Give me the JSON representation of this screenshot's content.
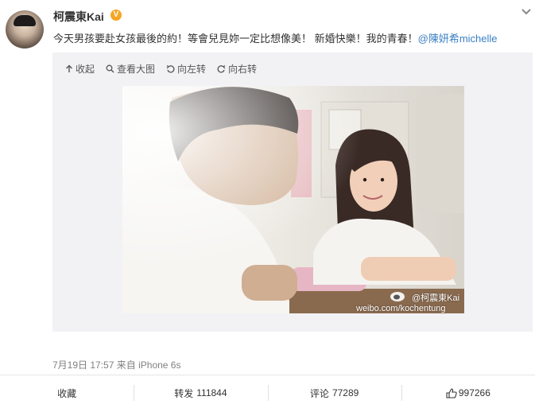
{
  "user": {
    "name": "柯震東Kai",
    "verified_badge": "V"
  },
  "post": {
    "text": "今天男孩要赴女孩最後的約！等會兒見妳一定比想像美！ 新婚快樂！我的青春！",
    "mention": "@陳妍希michelle"
  },
  "toolbar": {
    "collapse": "收起",
    "view_large": "查看大图",
    "rotate_left": "向左转",
    "rotate_right": "向右转"
  },
  "image": {
    "watermark_handle": "@柯震東Kai",
    "watermark_url": "weibo.com/kochentung"
  },
  "meta": {
    "date": "7月19日",
    "time": "17:57",
    "source_prefix": "来自",
    "device": "iPhone 6s"
  },
  "actions": {
    "favorite_label": "收藏",
    "repost_label": "转发",
    "repost_count": "111844",
    "comment_label": "评论",
    "comment_count": "77289",
    "like_count": "997266"
  },
  "icons": {
    "collapse": "arrow-up-icon",
    "view_large": "magnifier-icon",
    "rotate_left": "rotate-left-icon",
    "rotate_right": "rotate-right-icon",
    "like": "thumbs-up-icon",
    "menu": "chevron-down-icon"
  },
  "colors": {
    "mention": "#3b7fc4",
    "verified": "#f5a623",
    "media_bg": "#f2f2f5"
  }
}
